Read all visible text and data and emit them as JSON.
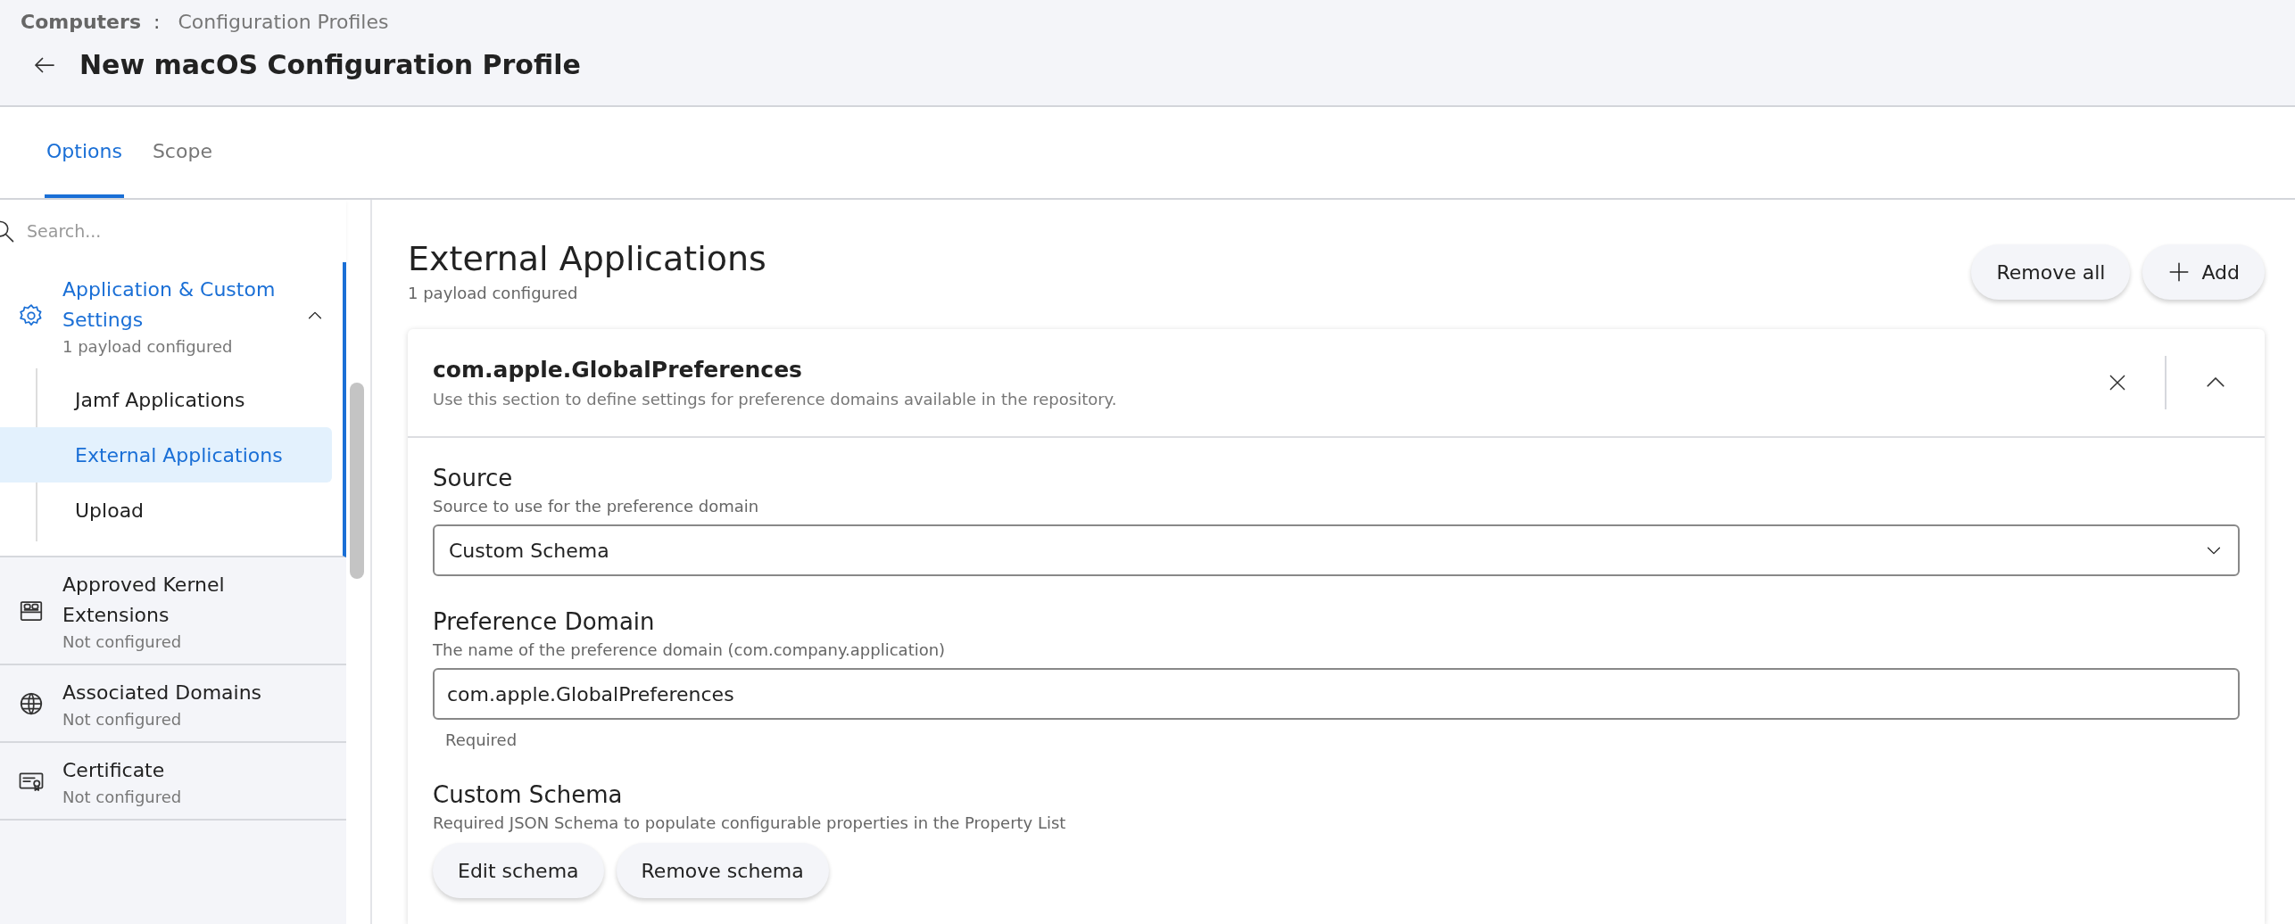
{
  "breadcrumb": {
    "parent": "Computers",
    "separator": ":",
    "current": "Configuration Profiles"
  },
  "page_title": "New macOS Configuration Profile",
  "tabs": [
    {
      "label": "Options",
      "selected": true
    },
    {
      "label": "Scope",
      "selected": false
    }
  ],
  "sidebar": {
    "search": {
      "placeholder": "Search..."
    },
    "sections": [
      {
        "title": "Application & Custom Settings",
        "status": "1 payload configured",
        "selected": true,
        "expanded": true,
        "children": [
          {
            "label": "Jamf Applications",
            "selected": false
          },
          {
            "label": "External Applications",
            "selected": true
          },
          {
            "label": "Upload",
            "selected": false
          }
        ]
      },
      {
        "title": "Approved Kernel Extensions",
        "status": "Not configured",
        "selected": false,
        "expanded": false
      },
      {
        "title": "Associated Domains",
        "status": "Not configured",
        "selected": false,
        "expanded": false
      },
      {
        "title": "Certificate",
        "status": "Not configured",
        "selected": false,
        "expanded": false
      }
    ]
  },
  "main": {
    "title": "External Applications",
    "subtitle": "1 payload configured",
    "actions": [
      {
        "label": "Remove all",
        "kind": "plain"
      },
      {
        "label": "Add",
        "kind": "add"
      }
    ],
    "payload": {
      "title": "com.apple.GlobalPreferences",
      "description": "Use this section to define settings for preference domains available in the repository.",
      "expanded": true,
      "fields": [
        {
          "kind": "select",
          "label": "Source",
          "description": "Source to use for the preference domain",
          "value": "Custom Schema"
        },
        {
          "kind": "text",
          "label": "Preference Domain",
          "description": "The name of the preference domain (com.company.application)",
          "value": "com.apple.GlobalPreferences",
          "note": "Required"
        },
        {
          "kind": "buttons",
          "label": "Custom Schema",
          "description": "Required JSON Schema to populate configurable properties in the Property List",
          "buttons": [
            "Edit schema",
            "Remove schema"
          ]
        }
      ]
    }
  }
}
